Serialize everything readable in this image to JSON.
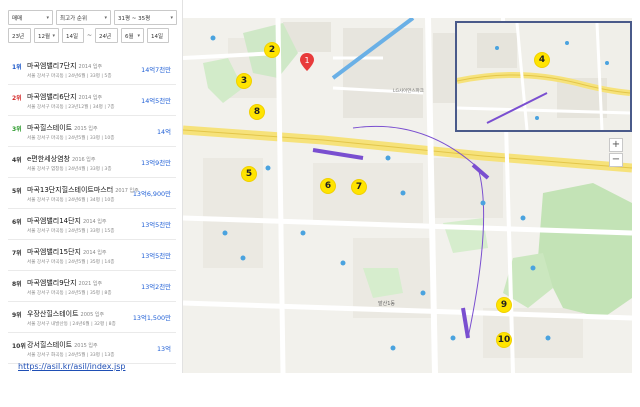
{
  "filters": {
    "row1": [
      "매매",
      "최고가 순위",
      "31평 ~ 35평"
    ],
    "row2": [
      "23년",
      "12월",
      "14일",
      "~",
      "24년",
      "6월",
      "14일"
    ]
  },
  "items": [
    {
      "rank": "1위",
      "name": "마곡엠밸리7단지",
      "year": "2014 입주",
      "sub": "서울 강서구 마곡동 | 24년6월 | 33평 | 5층",
      "price": "14억7천만",
      "rankColor": "blue"
    },
    {
      "rank": "2위",
      "name": "마곡엠밸리6단지",
      "year": "2014 입주",
      "sub": "서울 강서구 마곡동 | 23년12월 | 34평 | 7층",
      "price": "14억5천만",
      "rankColor": "red"
    },
    {
      "rank": "3위",
      "name": "마곡힐스테이트",
      "year": "2015 입주",
      "sub": "서울 강서구 마곡동 | 24년5월 | 33평 | 10층",
      "price": "14억",
      "rankColor": "green"
    },
    {
      "rank": "4위",
      "name": "e편한세상염창",
      "year": "2016 입주",
      "sub": "서울 강서구 염창동 | 24년4월 | 33평 | 3층",
      "price": "13억9천만",
      "rankColor": "black"
    },
    {
      "rank": "5위",
      "name": "마곡13단지힐스테이트마스터",
      "year": "2017 입주",
      "sub": "서울 강서구 마곡동 | 24년6월 | 34평 | 10층",
      "price": "13억6,900만",
      "rankColor": "black"
    },
    {
      "rank": "6위",
      "name": "마곡엠밸리14단지",
      "year": "2014 입주",
      "sub": "서울 강서구 마곡동 | 24년5월 | 33평 | 15층",
      "price": "13억5천만",
      "rankColor": "black"
    },
    {
      "rank": "7위",
      "name": "마곡엠밸리15단지",
      "year": "2014 입주",
      "sub": "서울 강서구 마곡동 | 24년5월 | 35평 | 14층",
      "price": "13억5천만",
      "rankColor": "black"
    },
    {
      "rank": "8위",
      "name": "마곡엠밸리9단지",
      "year": "2021 입주",
      "sub": "서울 강서구 마곡동 | 24년5월 | 35평 | 8층",
      "price": "13억2천만",
      "rankColor": "black"
    },
    {
      "rank": "9위",
      "name": "우장산힐스테이트",
      "year": "2005 입주",
      "sub": "서울 강서구 내발산동 | 24년6월 | 32평 | 8층",
      "price": "13억1,500만",
      "rankColor": "black"
    },
    {
      "rank": "10위",
      "name": "강서힐스테이트",
      "year": "2015 입주",
      "sub": "서울 강서구 화곡동 | 24년5월 | 33평 | 13층",
      "price": "13억",
      "rankColor": "black"
    }
  ],
  "link": "https://asil.kr/asil/index.jsp",
  "map": {
    "markers": [
      "2",
      "3",
      "8",
      "5",
      "6",
      "7",
      "9",
      "10"
    ],
    "inset_marker": "4",
    "pin_label": "1",
    "district_label": "발산1동",
    "landmark_label": "LG사이언스파크",
    "zoom_in": "+",
    "zoom_out": "−"
  }
}
